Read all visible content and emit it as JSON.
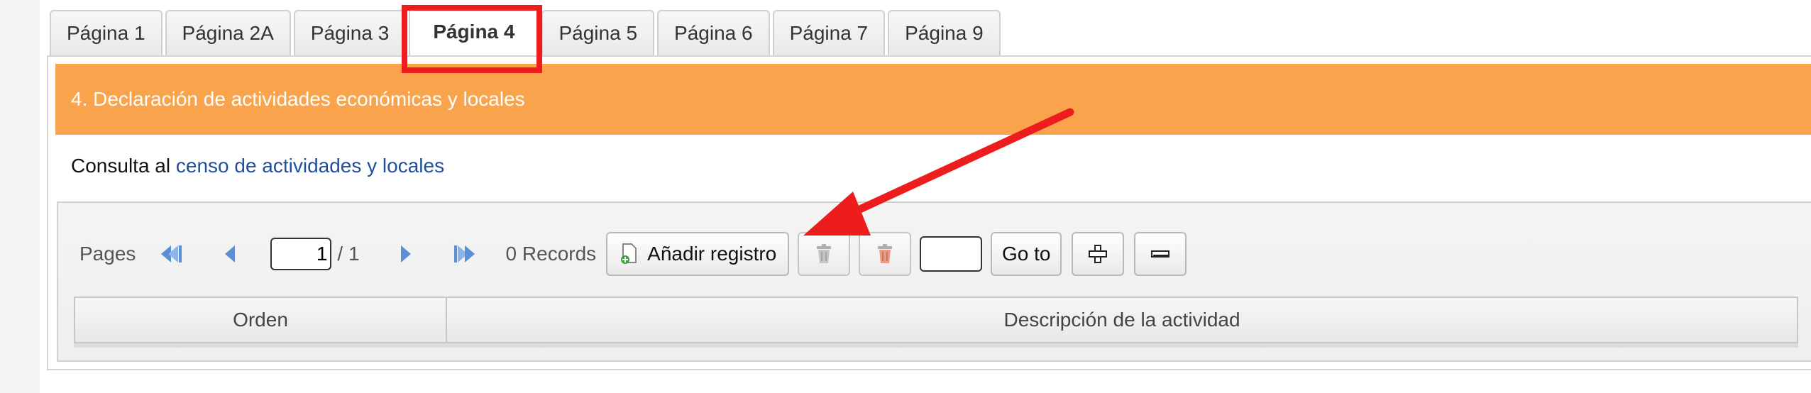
{
  "tabs": [
    {
      "label": "Página 1",
      "active": false
    },
    {
      "label": "Página 2A",
      "active": false
    },
    {
      "label": "Página 3",
      "active": false
    },
    {
      "label": "Página 4",
      "active": true
    },
    {
      "label": "Página 5",
      "active": false
    },
    {
      "label": "Página 6",
      "active": false
    },
    {
      "label": "Página 7",
      "active": false
    },
    {
      "label": "Página 9",
      "active": false
    }
  ],
  "section": {
    "title": "4. Declaración de actividades económicas y locales",
    "color": "#f9a34c"
  },
  "consulta": {
    "prefix": "Consulta al",
    "link_text": "censo de actividades y locales",
    "link_color": "#1f4f9e"
  },
  "pager": {
    "label": "Pages",
    "current_page": "1",
    "total_pages": "/ 1",
    "records": "0 Records"
  },
  "toolbar": {
    "add_label": "Añadir registro",
    "goto_label": "Go to",
    "goto_value": ""
  },
  "table": {
    "columns": [
      "Orden",
      "Descripción de la actividad"
    ]
  },
  "icons": {
    "first": "first-page-icon",
    "prev": "prev-page-icon",
    "next": "next-page-icon",
    "last": "last-page-icon",
    "add": "add-record-icon",
    "delete": "trash-icon",
    "delete_all": "trash-red-icon",
    "expand": "plus-icon",
    "collapse": "minus-icon"
  },
  "annotation": {
    "highlight_color": "#ee1d1d"
  }
}
